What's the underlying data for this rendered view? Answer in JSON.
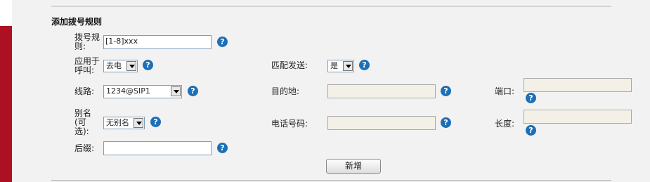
{
  "section_title": "添加拨号规则",
  "help_glyph": "?",
  "fields": {
    "dial_rule": {
      "label": "拨号规则:",
      "value": "[1-8]xxx"
    },
    "apply_to_call": {
      "label": "应用于呼叫:",
      "value": "去电"
    },
    "match_send": {
      "label": "匹配发送:",
      "value": "是"
    },
    "line": {
      "label": "线路:",
      "value": "1234@SIP1"
    },
    "destination": {
      "label": "目的地:",
      "value": ""
    },
    "port": {
      "label": "端口:",
      "value": ""
    },
    "alias": {
      "label": "别名(可选):",
      "value": "无别名"
    },
    "phone_number": {
      "label": "电话号码:",
      "value": ""
    },
    "length": {
      "label": "长度:",
      "value": ""
    },
    "suffix": {
      "label": "后缀:",
      "value": ""
    }
  },
  "add_button": "新增",
  "colors": {
    "accent_bar": "#ad1020",
    "help_icon": "#1d6fb6",
    "panel_bg": "#f2f2f2"
  }
}
